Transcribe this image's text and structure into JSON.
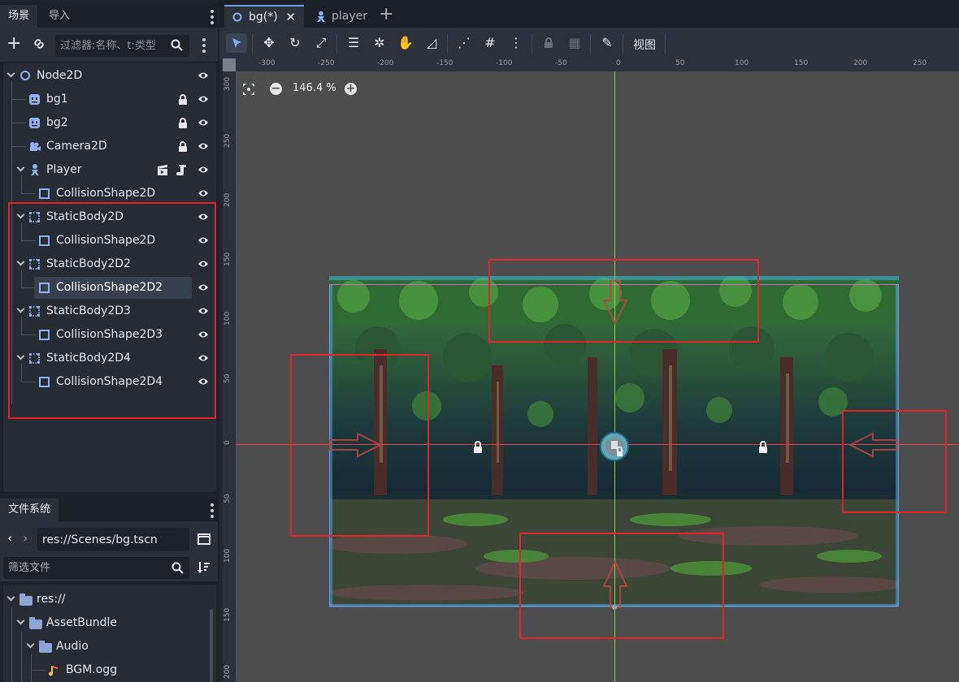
{
  "left_dock": {
    "tabs": [
      "场景",
      "导入"
    ],
    "filter_placeholder": "过滤器:名称、t:类型",
    "tree": [
      {
        "label": "Node2D",
        "icon": "node2d-circle-icon"
      },
      {
        "label": "bg1",
        "icon": "sprite-icon",
        "locked": true
      },
      {
        "label": "bg2",
        "icon": "sprite-icon",
        "locked": true
      },
      {
        "label": "Camera2D",
        "icon": "camera-icon",
        "locked": true
      },
      {
        "label": "Player",
        "icon": "character-icon",
        "has_scene": true
      },
      {
        "label": "CollisionShape2D",
        "icon": "collision-shape-icon"
      },
      {
        "label": "StaticBody2D",
        "icon": "static-body-icon"
      },
      {
        "label": "CollisionShape2D",
        "icon": "collision-shape-icon"
      },
      {
        "label": "StaticBody2D2",
        "icon": "static-body-icon"
      },
      {
        "label": "CollisionShape2D2",
        "icon": "collision-shape-icon",
        "selected": true
      },
      {
        "label": "StaticBody2D3",
        "icon": "static-body-icon"
      },
      {
        "label": "CollisionShape2D3",
        "icon": "collision-shape-icon"
      },
      {
        "label": "StaticBody2D4",
        "icon": "static-body-icon"
      },
      {
        "label": "CollisionShape2D4",
        "icon": "collision-shape-icon"
      }
    ]
  },
  "filesystem": {
    "tab": "文件系统",
    "path": "res://Scenes/bg.tscn",
    "filter_placeholder": "筛选文件",
    "items": [
      {
        "label": "res://",
        "type": "folder"
      },
      {
        "label": "AssetBundle",
        "type": "folder"
      },
      {
        "label": "Audio",
        "type": "folder"
      },
      {
        "label": "BGM.ogg",
        "type": "audio-file"
      }
    ]
  },
  "editor": {
    "doc_tabs": [
      {
        "label": "bg(*)",
        "active": true
      },
      {
        "label": "player",
        "active": false
      }
    ],
    "view_menu": "视图",
    "zoom": "146.4 %",
    "ruler_top": [
      "-300",
      "-250",
      "-200",
      "-150",
      "-100",
      "-50",
      "0",
      "50",
      "100",
      "150",
      "200",
      "250"
    ],
    "ruler_left": [
      "300",
      "250",
      "200",
      "150",
      "100",
      "50",
      "0",
      "50",
      "100",
      "150",
      "200"
    ]
  },
  "colors": {
    "accent": "#6a9de8",
    "annotation_red": "#e0242b",
    "collision_blue": "#44aee0",
    "axis_green": "#8bcf3c",
    "axis_red": "#e0424c",
    "bounds_pink": "#d65fc8"
  }
}
